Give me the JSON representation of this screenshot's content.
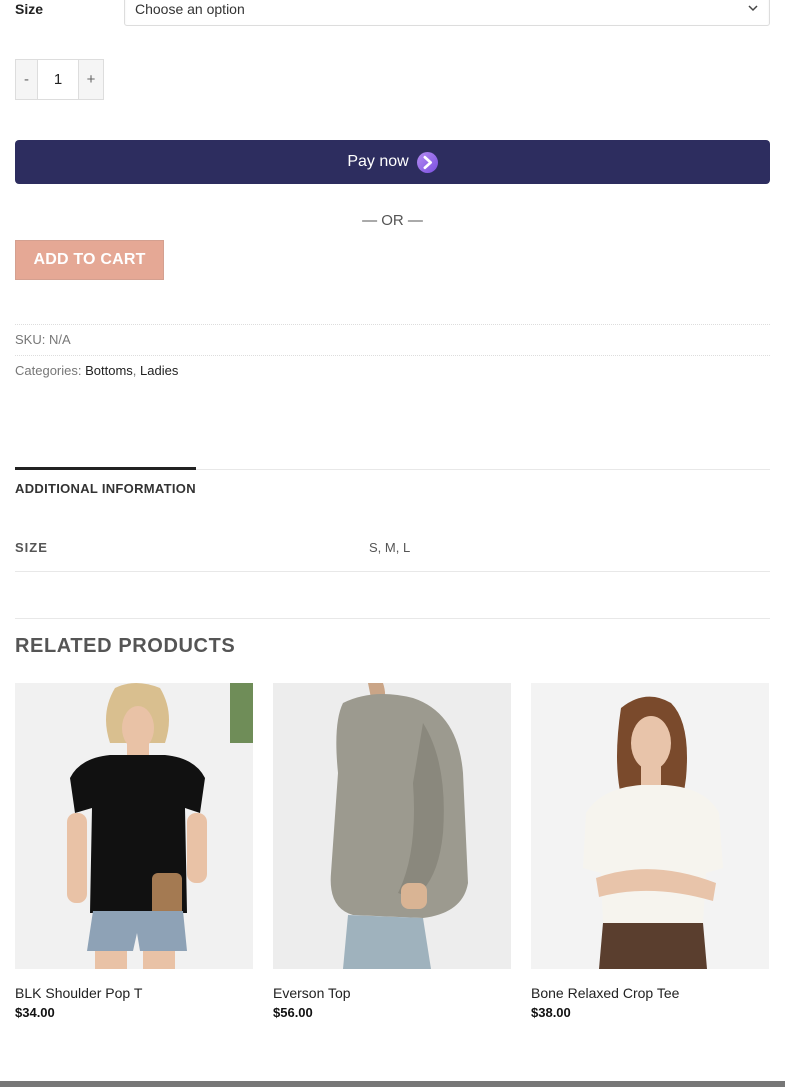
{
  "size_field": {
    "label": "Size",
    "selected": "Choose an option"
  },
  "quantity": {
    "minus": "-",
    "value": "1",
    "plus": "+"
  },
  "pay_now": {
    "label": "Pay now",
    "color": "#2d2d5f"
  },
  "or_text": "— OR —",
  "add_to_cart": {
    "label": "ADD TO CART",
    "color": "#e5a895"
  },
  "meta": {
    "sku_label": "SKU:",
    "sku_value": "N/A",
    "categories_label": "Categories:",
    "categories": [
      "Bottoms",
      "Ladies"
    ],
    "separator": ","
  },
  "tabs": [
    {
      "label": "ADDITIONAL INFORMATION",
      "active": true
    }
  ],
  "attributes": [
    {
      "name": "SIZE",
      "value": "S, M, L"
    }
  ],
  "related": {
    "title": "RELATED PRODUCTS",
    "products": [
      {
        "name": "BLK Shoulder Pop T",
        "price": "$34.00"
      },
      {
        "name": "Everson Top",
        "price": "$56.00"
      },
      {
        "name": "Bone Relaxed Crop Tee",
        "price": "$38.00"
      }
    ]
  },
  "icons": {
    "select_caret": "chevron-down-icon",
    "pay_arrow": "arrow-right-circle-icon"
  }
}
